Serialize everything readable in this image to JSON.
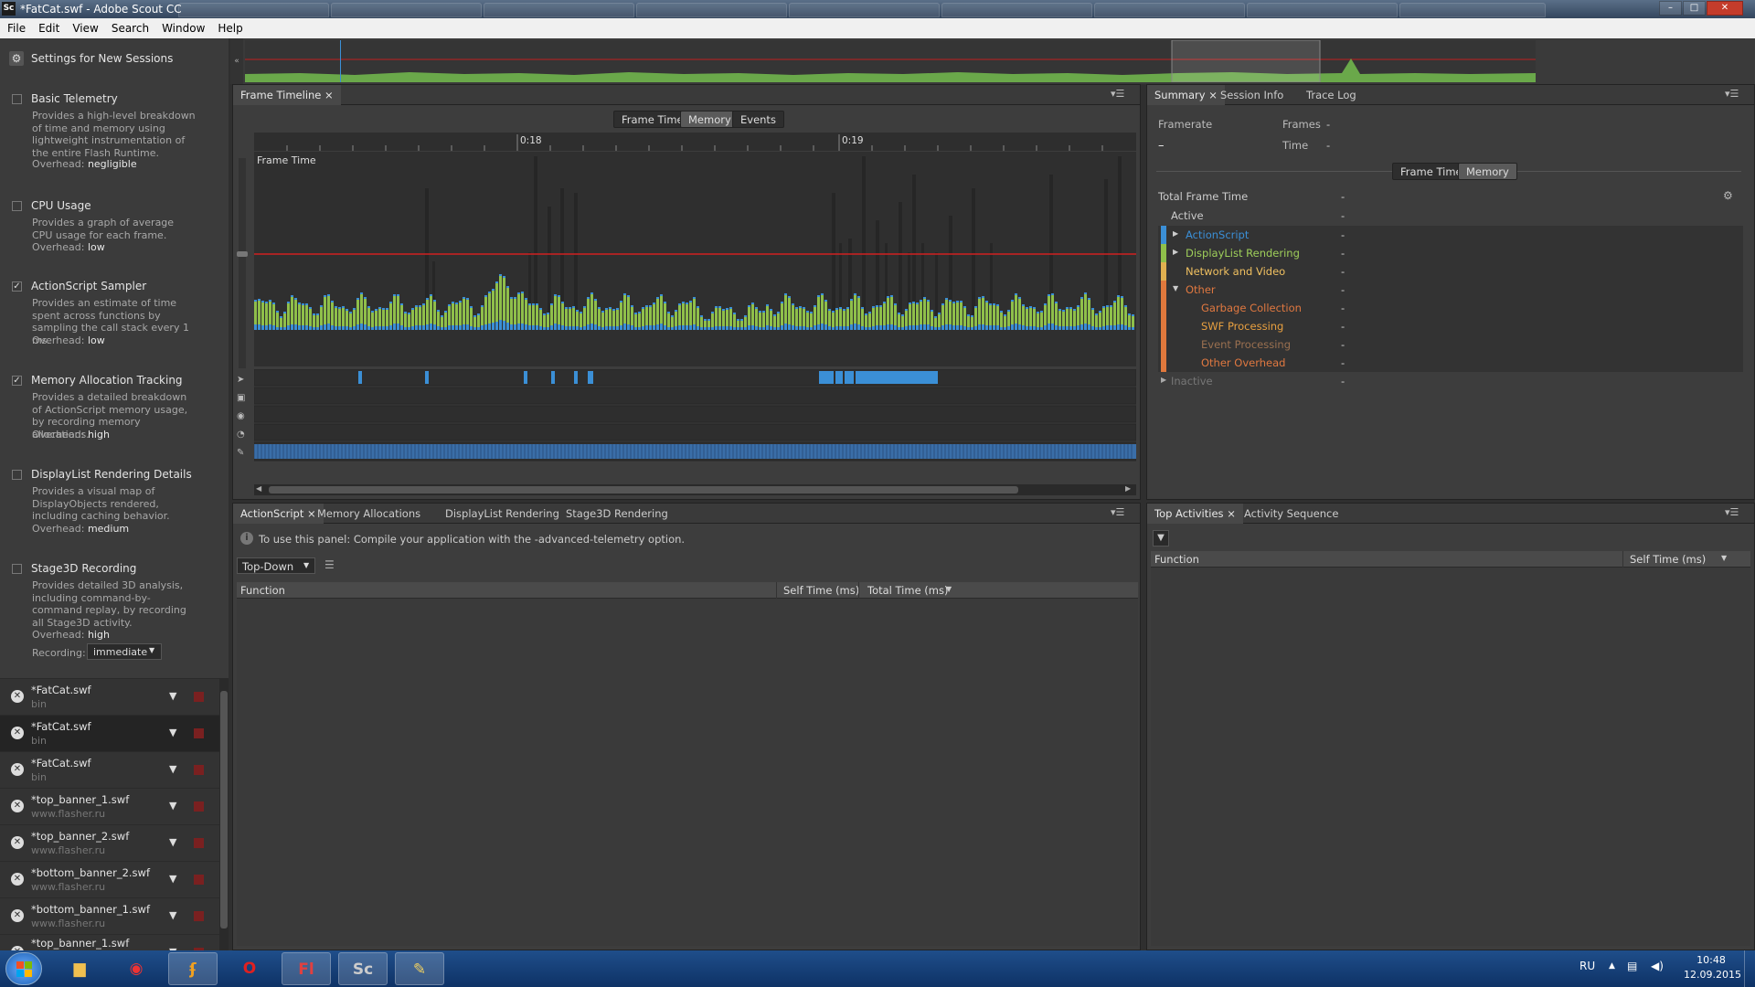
{
  "window": {
    "title": "*FatCat.swf - Adobe Scout CC",
    "app_icon": "Sc"
  },
  "menu": [
    "File",
    "Edit",
    "View",
    "Search",
    "Window",
    "Help"
  ],
  "settings": {
    "header": "Settings for New Sessions",
    "items": [
      {
        "label": "Basic Telemetry",
        "checked": false,
        "desc": "Provides a high-level breakdown of time and memory using lightweight instrumentation of the entire Flash Runtime.",
        "overhead": "negligible"
      },
      {
        "label": "CPU Usage",
        "checked": false,
        "desc": "Provides a graph of average CPU usage for each frame.",
        "overhead": "low"
      },
      {
        "label": "ActionScript Sampler",
        "checked": true,
        "desc": "Provides an estimate of time spent across functions by sampling the call stack every 1 ms.",
        "overhead": "low"
      },
      {
        "label": "Memory Allocation Tracking",
        "checked": true,
        "desc": "Provides a detailed breakdown of ActionScript memory usage, by recording memory allocations.",
        "overhead": "high"
      },
      {
        "label": "DisplayList Rendering Details",
        "checked": false,
        "desc": "Provides a visual map of DisplayObjects rendered, including caching behavior.",
        "overhead": "medium"
      },
      {
        "label": "Stage3D Recording",
        "checked": false,
        "desc": "Provides detailed 3D analysis, including command-by-command replay, by recording all Stage3D activity.",
        "overhead": "high"
      }
    ],
    "overhead_label": "Overhead:",
    "recording_label": "Recording:",
    "recording_value": "immediate"
  },
  "sessions": [
    {
      "name": "*FatCat.swf",
      "domain": "bin"
    },
    {
      "name": "*FatCat.swf",
      "domain": "bin"
    },
    {
      "name": "*FatCat.swf",
      "domain": "bin"
    },
    {
      "name": "*top_banner_1.swf",
      "domain": "www.flasher.ru"
    },
    {
      "name": "*top_banner_2.swf",
      "domain": "www.flasher.ru"
    },
    {
      "name": "*bottom_banner_2.swf",
      "domain": "www.flasher.ru"
    },
    {
      "name": "*bottom_banner_1.swf",
      "domain": "www.flasher.ru"
    },
    {
      "name": "*top_banner_1.swf",
      "domain": ""
    }
  ],
  "timeline": {
    "tab": "Frame Timeline",
    "modes": [
      "Frame Time",
      "Memory",
      "Events"
    ],
    "selected_mode": "Memory",
    "ruler": [
      "0:18",
      "0:19"
    ],
    "graph_label": "Frame Time"
  },
  "summary": {
    "tabs": [
      "Summary",
      "Session Info",
      "Trace Log"
    ],
    "framerate_label": "Framerate",
    "framerate_value": "–",
    "frames_label": "Frames",
    "frames_value": "-",
    "time_label": "Time",
    "time_value": "-",
    "modes": [
      "Frame Time",
      "Memory"
    ],
    "selected_mode": "Memory",
    "total_label": "Total Frame Time",
    "total_value": "-",
    "active_label": "Active",
    "active_value": "-",
    "rows": [
      {
        "name": "ActionScript",
        "value": "-",
        "color": "#3b8fd6"
      },
      {
        "name": "DisplayList Rendering",
        "value": "-",
        "color": "#8fbf4a"
      },
      {
        "name": "Network and Video",
        "value": "-",
        "color": "#e0b050"
      },
      {
        "name": "Other",
        "value": "-",
        "color": "#e0783c"
      },
      {
        "name": "Garbage Collection",
        "value": "-",
        "color": "#e0783c"
      },
      {
        "name": "SWF Processing",
        "value": "-",
        "color": "#e0783c"
      },
      {
        "name": "Event Processing",
        "value": "-",
        "color": "#e0783c"
      },
      {
        "name": "Other Overhead",
        "value": "-",
        "color": "#e0783c"
      }
    ],
    "inactive_label": "Inactive",
    "inactive_value": "-"
  },
  "bottom": {
    "tabs": [
      "ActionScript",
      "Memory Allocations",
      "DisplayList Rendering",
      "Stage3D Rendering"
    ],
    "info": "To use this panel: Compile your application with the -advanced-telemetry option.",
    "view_mode": "Top-Down",
    "columns": [
      "Function",
      "Self Time (ms)",
      "Total Time (ms)"
    ]
  },
  "activities": {
    "tabs": [
      "Top Activities",
      "Activity Sequence"
    ],
    "columns": [
      "Function",
      "Self Time (ms)"
    ]
  },
  "taskbar": {
    "lang": "RU",
    "time": "10:48",
    "date": "12.09.2015",
    "apps": [
      "windows-explorer",
      "chrome",
      "flash-builder",
      "opera",
      "flash-professional",
      "scout",
      "paint"
    ]
  },
  "colors": {
    "as": "#3b8fd6",
    "dl": "#8fbf4a",
    "net": "#e0b050",
    "other": "#e0783c",
    "budget": "#d02020"
  }
}
